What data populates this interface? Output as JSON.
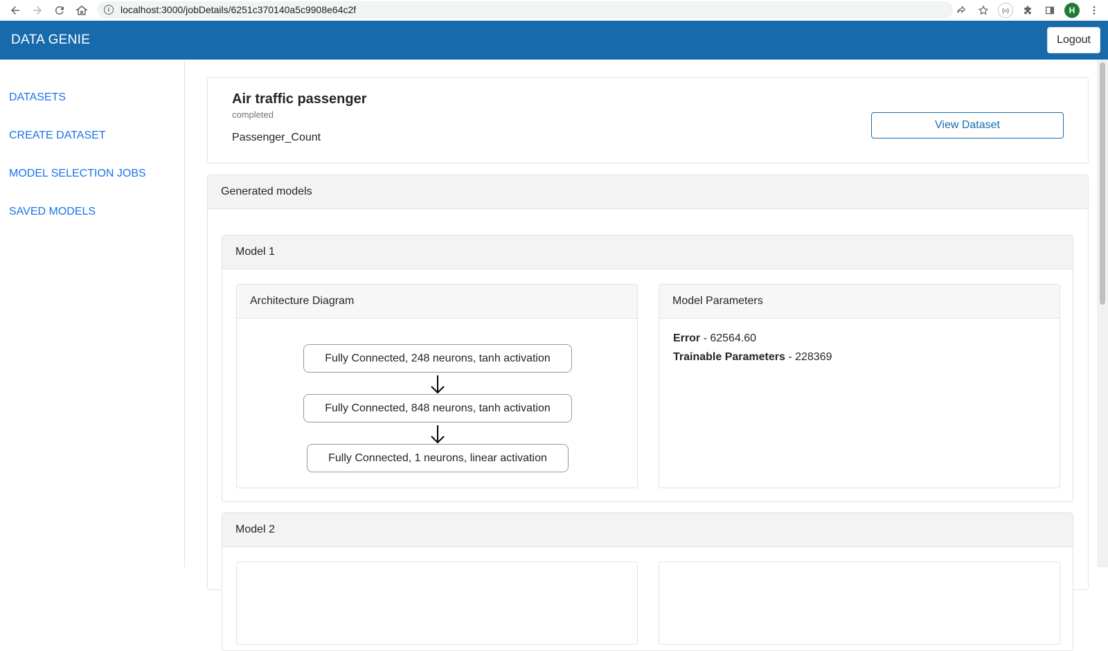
{
  "browser": {
    "url": "localhost:3000/jobDetails/6251c370140a5c9908e64c2f",
    "profile_initial": "H",
    "ext_badge": "{=}"
  },
  "header": {
    "brand": "DATA GENIE",
    "logout_label": "Logout",
    "color": "#176bac"
  },
  "sidebar": {
    "items": [
      {
        "label": "DATASETS"
      },
      {
        "label": "CREATE DATASET"
      },
      {
        "label": "MODEL SELECTION JOBS"
      },
      {
        "label": "SAVED MODELS"
      }
    ]
  },
  "job": {
    "title": "Air traffic passenger",
    "status": "completed",
    "target": "Passenger_Count",
    "view_button": "View Dataset"
  },
  "models_section": {
    "title": "Generated models",
    "models": [
      {
        "name": "Model 1",
        "architecture_title": "Architecture Diagram",
        "layers": [
          "Fully Connected, 248 neurons, tanh activation",
          "Fully Connected, 848 neurons, tanh activation",
          "Fully Connected, 1 neurons, linear activation"
        ],
        "params_title": "Model Parameters",
        "error_label": "Error",
        "error_value": " - 62564.60",
        "trainable_label": "Trainable Parameters",
        "trainable_value": " - 228369"
      },
      {
        "name": "Model 2"
      }
    ]
  }
}
